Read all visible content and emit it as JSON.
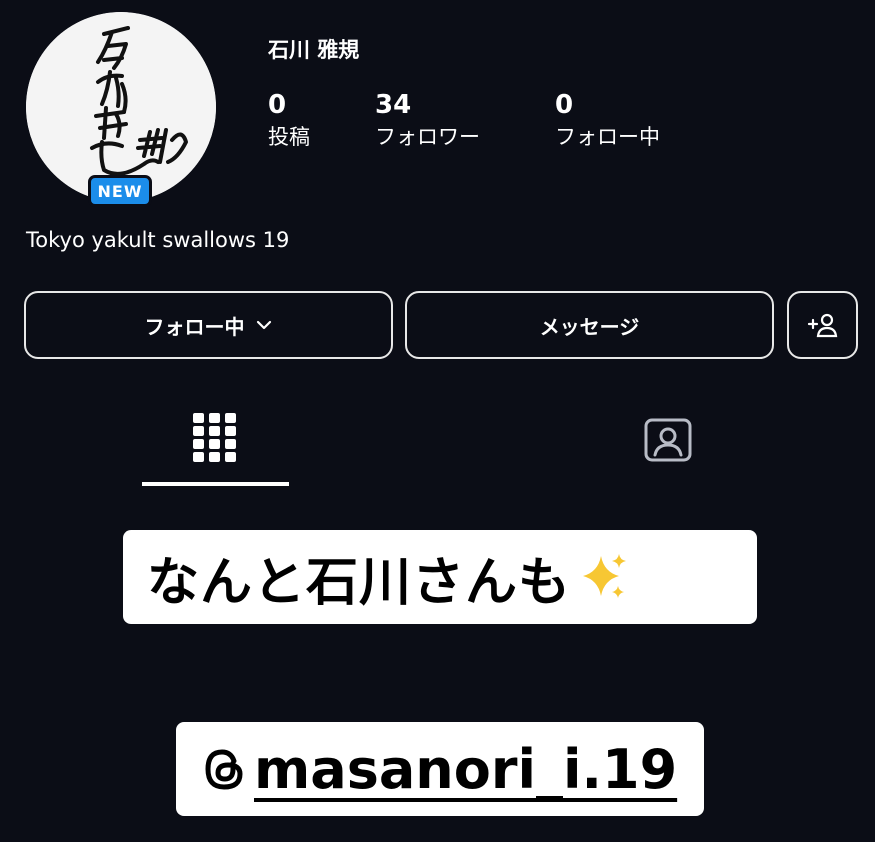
{
  "profile": {
    "name": "石川 雅規",
    "badge": "NEW",
    "bio": "Tokyo yakult swallows 19",
    "avatar_icon": "signature-avatar",
    "stats": [
      {
        "value": "0",
        "label": "投稿"
      },
      {
        "value": "34",
        "label": "フォロワー"
      },
      {
        "value": "0",
        "label": "フォロー中"
      }
    ]
  },
  "actions": {
    "follow_label": "フォロー中",
    "message_label": "メッセージ",
    "suggest_icon": "add-person-icon"
  },
  "tabs": [
    {
      "icon": "grid-icon",
      "active": true
    },
    {
      "icon": "tagged-icon",
      "active": false
    }
  ],
  "overlays": {
    "caption": "なんと石川さんも",
    "handle": "masanori_i.19",
    "handle_icon": "threads-icon"
  },
  "colors": {
    "background": "#0b0d16",
    "badge": "#1b8dea",
    "overlay_bg": "#ffffff"
  }
}
